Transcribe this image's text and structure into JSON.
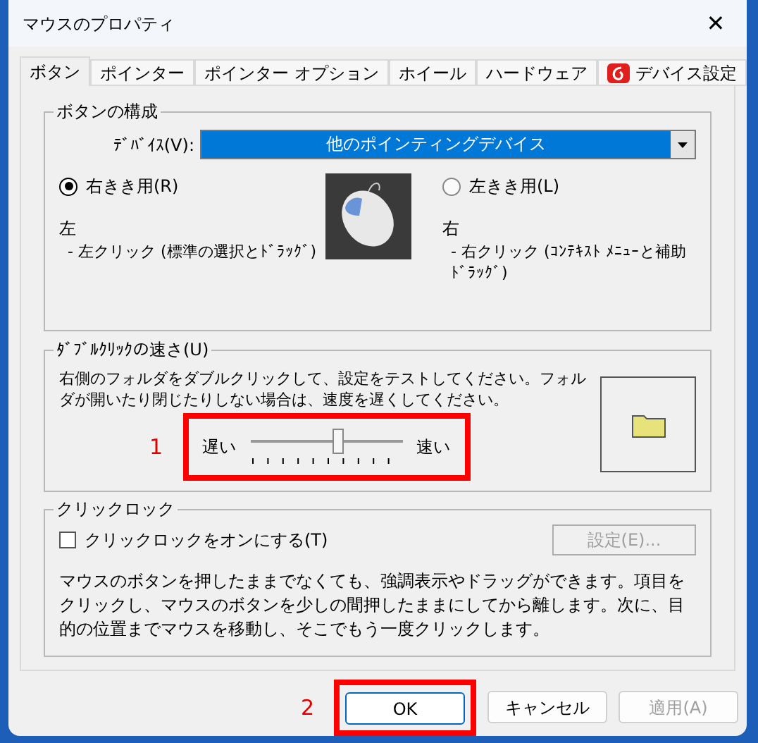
{
  "window": {
    "title": "マウスのプロパティ",
    "close": "✕"
  },
  "tabs": [
    {
      "label": "ボタン",
      "selected": true,
      "kind": "text"
    },
    {
      "label": "ポインター",
      "selected": false,
      "kind": "text"
    },
    {
      "label": "ポインター オプション",
      "selected": false,
      "kind": "text"
    },
    {
      "label": "ホイール",
      "selected": false,
      "kind": "text"
    },
    {
      "label": "ハードウェア",
      "selected": false,
      "kind": "text"
    },
    {
      "label": "デバイス設定",
      "selected": false,
      "kind": "app"
    }
  ],
  "button_config": {
    "title": "ボタンの構成",
    "device_label": "ﾃﾞﾊﾞｲｽ(V):",
    "device_value": "他のポインティングデバイス",
    "options": [
      {
        "label": "右きき用(R)",
        "selected": true,
        "side": "左",
        "description": "- 左クリック (標準の選択とﾄﾞﾗｯｸﾞ)"
      },
      {
        "label": "左きき用(L)",
        "selected": false,
        "side": "右",
        "description": "- 右クリック (ｺﾝﾃｷｽﾄ ﾒﾆｭｰと補助ﾄﾞﾗｯｸﾞ)"
      }
    ]
  },
  "double_click": {
    "title": "ﾀﾞﾌﾞﾙｸﾘｯｸの速さ(U)",
    "description": "右側のフォルダをダブルクリックして、設定をテストしてください。フォルダが開いたり閉じたりしない場合は、速度を遅くしてください。",
    "slow": "遅い",
    "fast": "速い",
    "level": 0.58,
    "annotation": "1"
  },
  "click_lock": {
    "title": "クリックロック",
    "checkbox": {
      "label": "クリックロックをオンにする(T)",
      "checked": false
    },
    "settings_button": {
      "label": "設定(E)...",
      "disabled": true
    },
    "description": "マウスのボタンを押したままでなくても、強調表示やドラッグができます。項目をクリックし、マウスのボタンを少しの間押したままにしてから離します。次に、目的の位置までマウスを移動し、そこでもう一度クリックします。"
  },
  "buttons": [
    {
      "label": "OK",
      "disabled": false,
      "default": true,
      "annotation": "2"
    },
    {
      "label": "キャンセル",
      "disabled": false,
      "default": false
    },
    {
      "label": "適用(A)",
      "disabled": true,
      "default": false
    }
  ]
}
